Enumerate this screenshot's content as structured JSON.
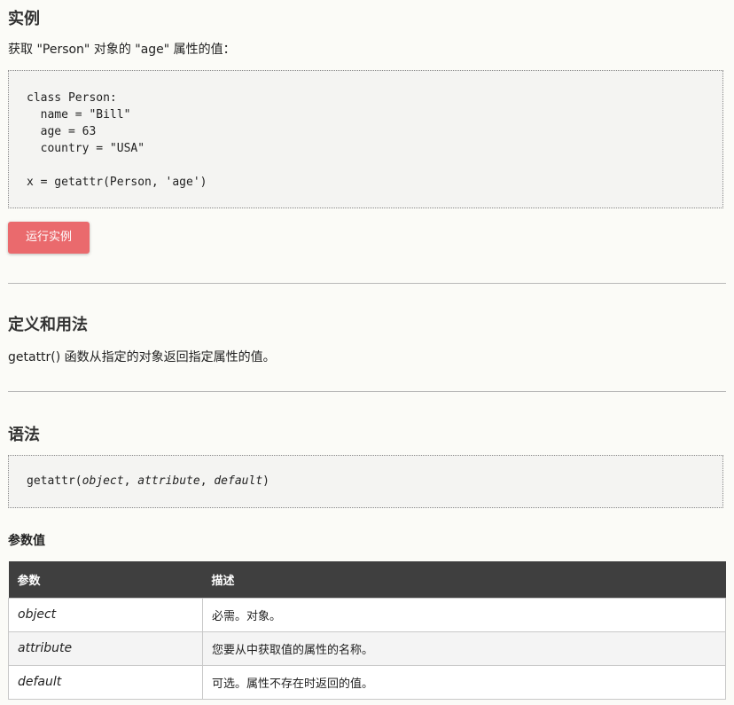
{
  "example": {
    "heading": "实例",
    "description": "获取 \"Person\" 对象的 \"age\" 属性的值：",
    "code": "class Person:\n  name = \"Bill\"\n  age = 63\n  country = \"USA\"\n\nx = getattr(Person, 'age')",
    "run_button": "运行实例"
  },
  "definition": {
    "heading": "定义和用法",
    "text": "getattr() 函数从指定的对象返回指定属性的值。"
  },
  "syntax": {
    "heading": "语法",
    "fn": "getattr(",
    "p1": "object",
    "sep1": ", ",
    "p2": "attribute",
    "sep2": ", ",
    "p3": "default",
    "close": ")"
  },
  "params": {
    "heading": "参数值",
    "col_param": "参数",
    "col_desc": "描述",
    "rows": [
      {
        "name": "object",
        "desc": "必需。对象。"
      },
      {
        "name": "attribute",
        "desc": "您要从中获取值的属性的名称。"
      },
      {
        "name": "default",
        "desc": "可选。属性不存在时返回的值。"
      }
    ]
  },
  "colors": {
    "background": "#fbfbf7",
    "button": "#ea6a6d",
    "table_header": "#3f3f3f"
  }
}
